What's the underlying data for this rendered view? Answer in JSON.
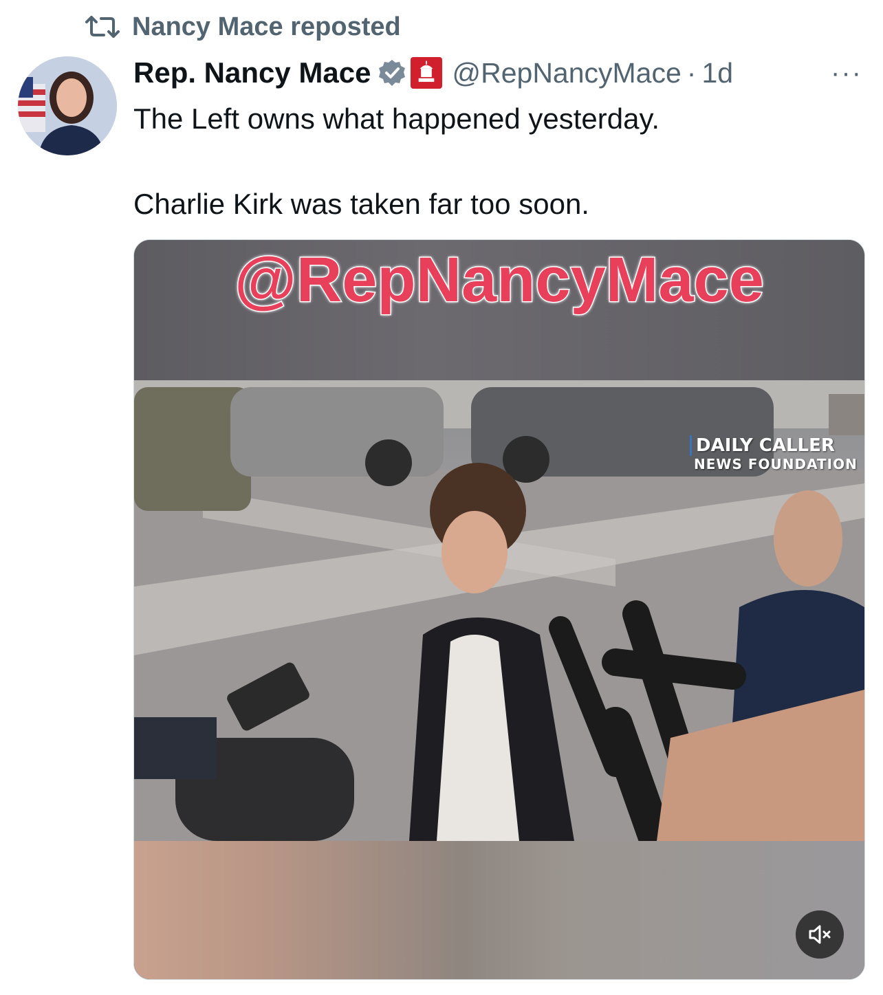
{
  "repost": {
    "icon": "repost-icon",
    "label": "Nancy Mace reposted"
  },
  "tweet": {
    "author_name": "Rep. Nancy Mace",
    "verified": "verified-badge-icon",
    "affiliation": "house-gop-badge-icon",
    "handle": "@RepNancyMace",
    "separator": "·",
    "time": "1d",
    "more": "···",
    "text_paragraphs": [
      "The Left owns what happened yesterday.",
      "Charlie Kirk was taken far too soon."
    ]
  },
  "media": {
    "watermark": "@RepNancyMace",
    "logo_line1": "DAILY CALLER",
    "logo_line2": "NEWS FOUNDATION",
    "mute_icon": "muted-speaker-icon"
  },
  "colors": {
    "secondary_text": "#536471",
    "verified_blue": "#7b8a99",
    "gop_red": "#d0202e",
    "watermark_pink": "#e8405b"
  }
}
